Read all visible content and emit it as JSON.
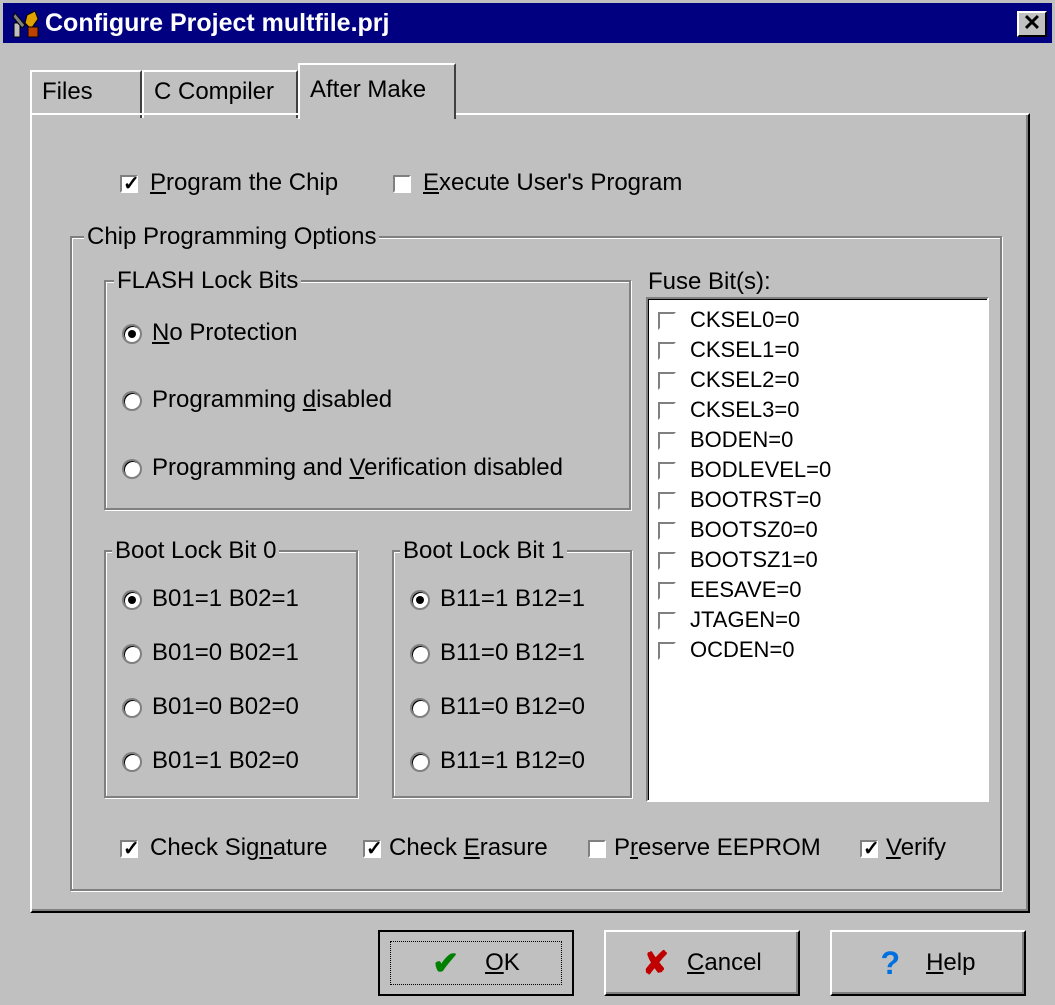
{
  "window": {
    "title": "Configure Project multfile.prj",
    "close_glyph": "✕"
  },
  "tabs": [
    {
      "label": "Files",
      "active": false
    },
    {
      "label": "C Compiler",
      "active": false
    },
    {
      "label": "After Make",
      "active": true
    }
  ],
  "top_options": {
    "program_chip": {
      "pre": "",
      "ul": "P",
      "post": "rogram the Chip",
      "checked": true
    },
    "execute_program": {
      "pre": "",
      "ul": "E",
      "post": "xecute User's Program",
      "checked": false
    }
  },
  "chip_programming": {
    "title": "Chip Programming Options",
    "flash_lock": {
      "title": "FLASH Lock Bits",
      "options": [
        {
          "pre": "",
          "ul": "N",
          "post": "o Protection",
          "checked": true
        },
        {
          "pre": "Programming ",
          "ul": "d",
          "post": "isabled",
          "checked": false
        },
        {
          "pre": "Programming and ",
          "ul": "V",
          "post": "erification disabled",
          "checked": false
        }
      ]
    },
    "boot_lock_0": {
      "title": "Boot Lock Bit 0",
      "options": [
        {
          "label": "B01=1 B02=1",
          "checked": true
        },
        {
          "label": "B01=0 B02=1",
          "checked": false
        },
        {
          "label": "B01=0 B02=0",
          "checked": false
        },
        {
          "label": "B01=1 B02=0",
          "checked": false
        }
      ]
    },
    "boot_lock_1": {
      "title": "Boot Lock Bit 1",
      "options": [
        {
          "label": "B11=1 B12=1",
          "checked": true
        },
        {
          "label": "B11=0 B12=1",
          "checked": false
        },
        {
          "label": "B11=0 B12=0",
          "checked": false
        },
        {
          "label": "B11=1 B12=0",
          "checked": false
        }
      ]
    },
    "fuse_bits": {
      "label": "Fuse Bit(s):",
      "items": [
        {
          "label": "CKSEL0=0",
          "checked": false
        },
        {
          "label": "CKSEL1=0",
          "checked": false
        },
        {
          "label": "CKSEL2=0",
          "checked": false
        },
        {
          "label": "CKSEL3=0",
          "checked": false
        },
        {
          "label": "BODEN=0",
          "checked": false
        },
        {
          "label": "BODLEVEL=0",
          "checked": false
        },
        {
          "label": "BOOTRST=0",
          "checked": false
        },
        {
          "label": "BOOTSZ0=0",
          "checked": false
        },
        {
          "label": "BOOTSZ1=0",
          "checked": false
        },
        {
          "label": "EESAVE=0",
          "checked": false
        },
        {
          "label": "JTAGEN=0",
          "checked": false
        },
        {
          "label": "OCDEN=0",
          "checked": false
        }
      ]
    },
    "bottom_checks": {
      "check_signature": {
        "pre": "Check Sig",
        "ul": "n",
        "post": "ature",
        "checked": true
      },
      "check_erasure": {
        "pre": "Check ",
        "ul": "E",
        "post": "rasure",
        "checked": true
      },
      "preserve_eeprom": {
        "pre": "P",
        "ul": "r",
        "post": "eserve EEPROM",
        "checked": false
      },
      "verify": {
        "pre": "",
        "ul": "V",
        "post": "erify",
        "checked": true
      }
    }
  },
  "buttons": {
    "ok": {
      "icon": "check-icon",
      "glyph": "✔",
      "color": "#008000",
      "pre": "",
      "ul": "O",
      "post": "K"
    },
    "cancel": {
      "icon": "x-icon",
      "glyph": "✘",
      "color": "#c00000",
      "pre": "",
      "ul": "C",
      "post": "ancel"
    },
    "help": {
      "icon": "question-icon",
      "glyph": "?",
      "color": "#0070e0",
      "pre": "",
      "ul": "H",
      "post": "elp"
    }
  }
}
